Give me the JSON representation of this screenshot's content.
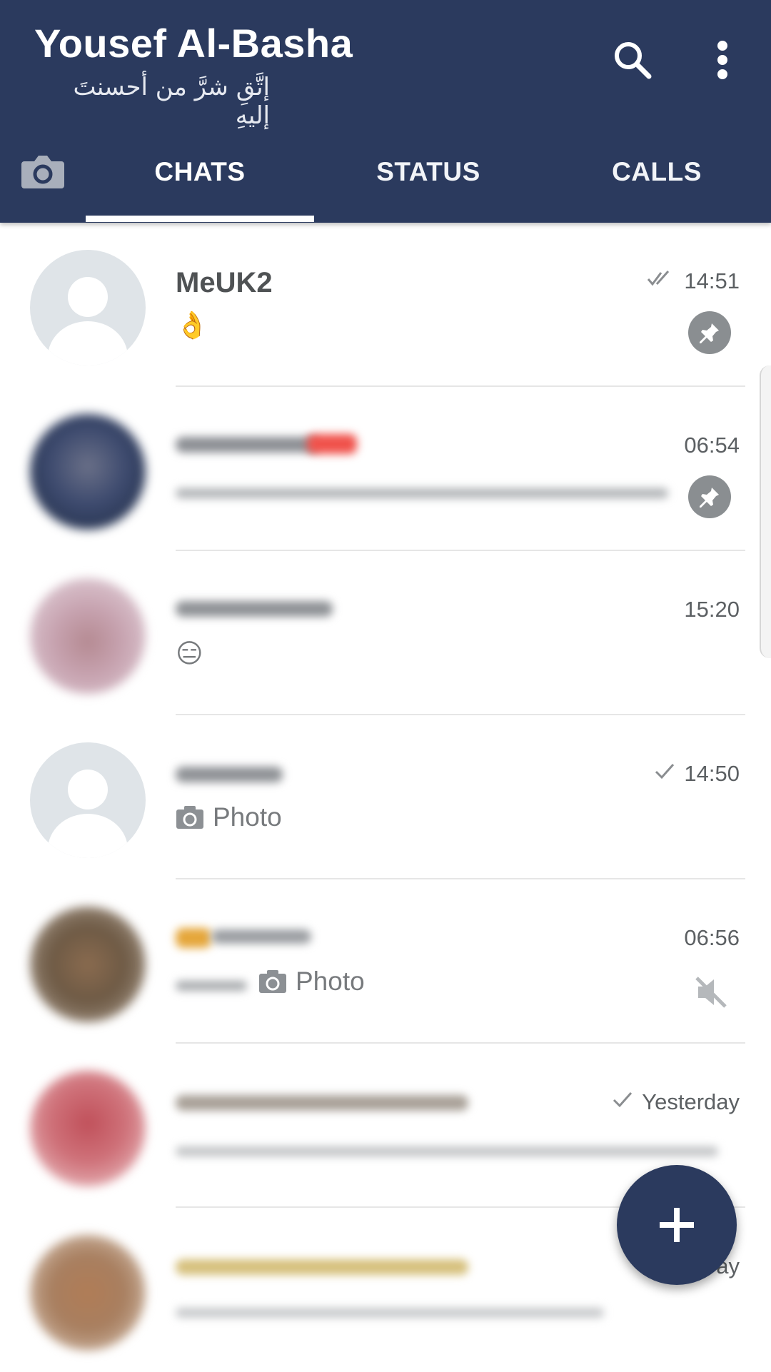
{
  "header": {
    "title": "Yousef Al-Basha",
    "subtitle": "إتَّقِ شرَّ من أحسنتَ إليهِ",
    "icons": [
      "search-icon",
      "more-vert-icon"
    ]
  },
  "tabs": [
    {
      "label": "CHATS",
      "active": true
    },
    {
      "label": "STATUS",
      "active": false
    },
    {
      "label": "CALLS",
      "active": false
    }
  ],
  "chats": [
    {
      "name": "MeUK2",
      "preview": "👌",
      "time": "14:51",
      "receipt": "double-check",
      "pinned": true
    },
    {
      "name": "",
      "preview": "",
      "time": "06:54",
      "receipt": "",
      "pinned": true
    },
    {
      "name": "",
      "preview": "😑",
      "time": "15:20",
      "receipt": "",
      "pinned": false
    },
    {
      "name": "",
      "preview": "Photo",
      "time": "14:50",
      "receipt": "single-check",
      "pinned": false
    },
    {
      "name": "",
      "preview": "Photo",
      "time": "06:56",
      "receipt": "",
      "muted": true
    },
    {
      "name": "",
      "preview": "",
      "time": "Yesterday",
      "receipt": "single-check"
    },
    {
      "name": "",
      "preview": "",
      "time": "ay",
      "receipt": ""
    }
  ],
  "colors": {
    "header": "#2b3a5e",
    "fab": "#2b3a5e"
  },
  "fab": {
    "icon": "plus-icon"
  }
}
